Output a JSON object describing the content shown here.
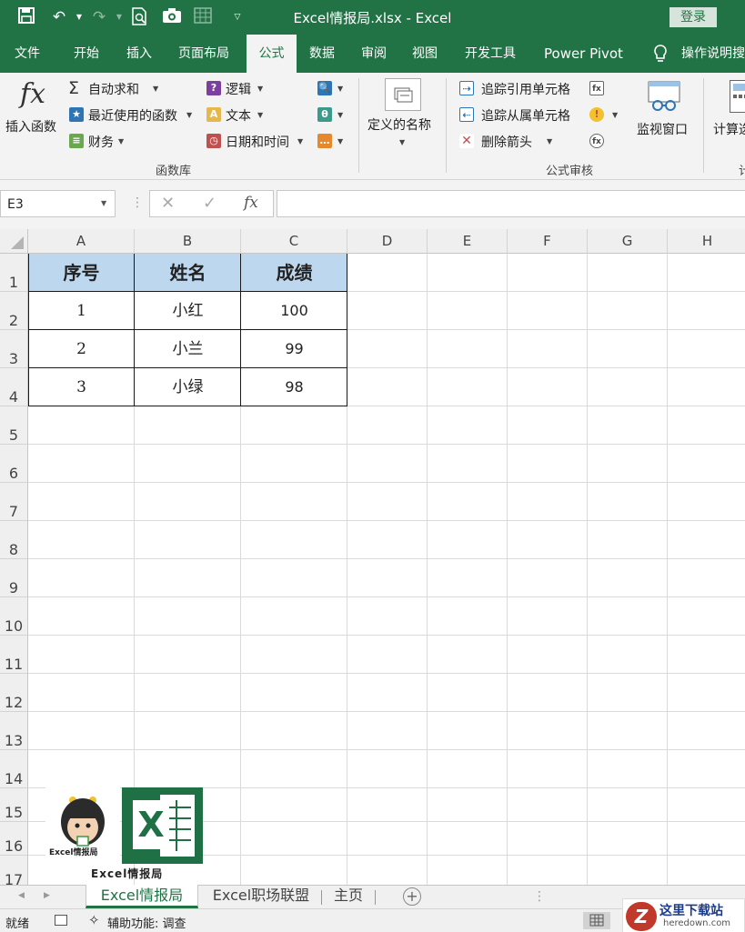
{
  "app": {
    "doc_title": "Excel情报局.xlsx  -  Excel",
    "login": "登录"
  },
  "tabs": [
    "文件",
    "开始",
    "插入",
    "页面布局",
    "公式",
    "数据",
    "审阅",
    "视图",
    "开发工具",
    "Power Pivot",
    "操作说明搜"
  ],
  "active_tab": "公式",
  "ribbon": {
    "insert_function": "插入函数",
    "fx_glyph": "fx",
    "autosum": "自动求和",
    "recently_used": "最近使用的函数",
    "financial": "财务",
    "logical": "逻辑",
    "text": "文本",
    "date_time": "日期和时间",
    "group_function_library": "函数库",
    "defined_names": "定义的名称",
    "trace_precedents": "追踪引用单元格",
    "trace_dependents": "追踪从属单元格",
    "remove_arrows": "删除箭头",
    "watch_window": "监视窗口",
    "group_formula_auditing": "公式审核",
    "calculation": "计算选",
    "group_calculation": "计"
  },
  "formula_bar": {
    "name_box": "E3",
    "formula": ""
  },
  "grid": {
    "columns": [
      "A",
      "B",
      "C",
      "D",
      "E",
      "F",
      "G",
      "H"
    ],
    "rows": [
      "1",
      "2",
      "3",
      "4",
      "5",
      "6",
      "7",
      "8",
      "9",
      "10",
      "11",
      "12",
      "13",
      "14",
      "15",
      "16",
      "17"
    ],
    "table_headers": [
      "序号",
      "姓名",
      "成绩"
    ],
    "table_rows": [
      [
        "1",
        "小红",
        "100"
      ],
      [
        "2",
        "小兰",
        "99"
      ],
      [
        "3",
        "小绿",
        "98"
      ]
    ]
  },
  "logo": {
    "avatar_caption": "Excel情报局",
    "excel_letter": "X",
    "caption": "Excel情报局"
  },
  "sheets": [
    "Excel情报局",
    "Excel职场联盟",
    "主页"
  ],
  "active_sheet": "Excel情报局",
  "status": {
    "ready": "就绪",
    "accessibility": "辅助功能: 调查"
  },
  "watermark": {
    "text": "这里下载站",
    "url": "heredown.com"
  },
  "colors": {
    "excel_green": "#217346",
    "header_fill": "#bdd7ee"
  }
}
